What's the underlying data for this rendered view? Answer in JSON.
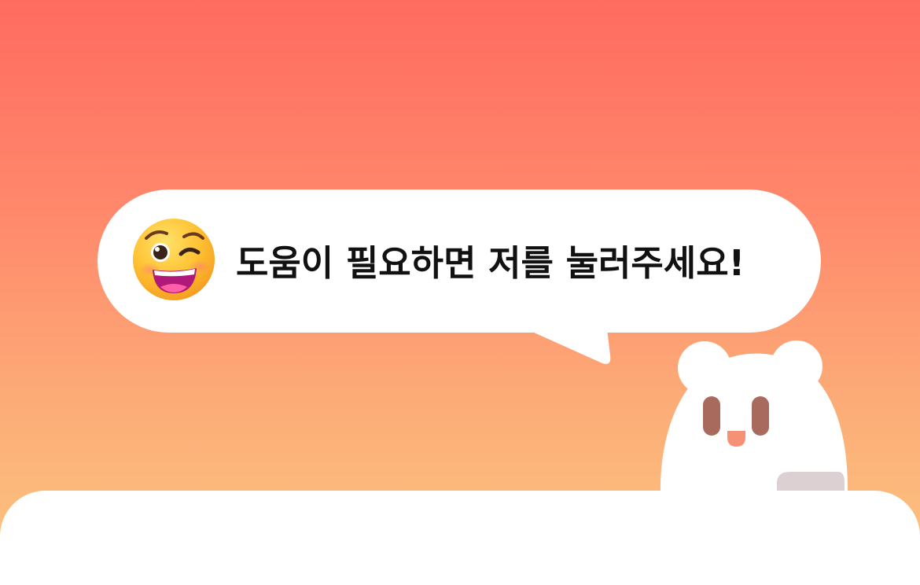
{
  "banner": {
    "message": "도움이 필요하면 저를 눌러주세요!",
    "emoji_icon": "winking-grinning-face-icon",
    "mascot_icon": "white-bear-mascot-icon"
  },
  "colors": {
    "gradient_top": "#ff6b60",
    "gradient_bottom": "#fcc27f",
    "bubble": "#ffffff",
    "text": "#111111",
    "mascot_body": "#ffffff",
    "mascot_eyes": "#a86a5c",
    "mascot_mouth": "#f59176"
  }
}
